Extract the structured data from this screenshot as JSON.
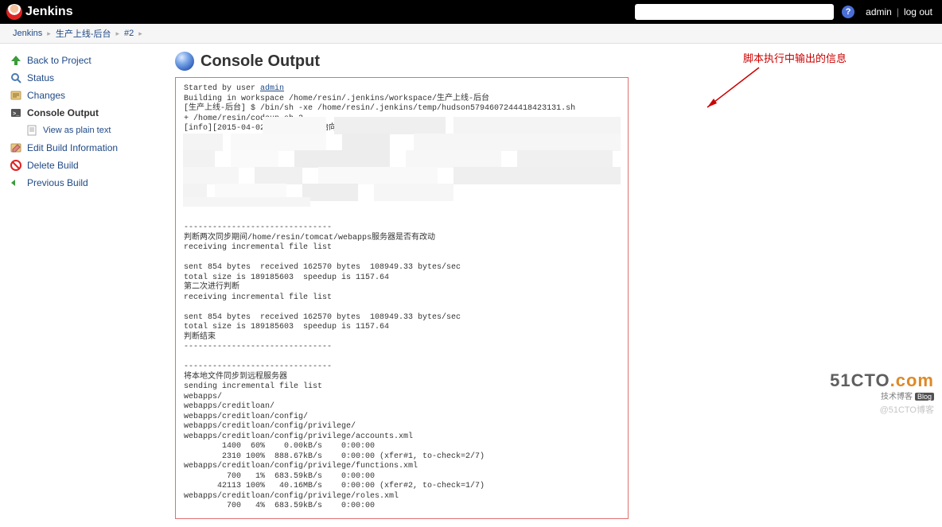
{
  "header": {
    "brand": "Jenkins",
    "search_placeholder": "",
    "admin_label": "admin",
    "logout_label": "log out"
  },
  "breadcrumbs": {
    "items": [
      "Jenkins",
      "生产上线-后台",
      "#2"
    ]
  },
  "sidebar": {
    "back": "Back to Project",
    "status": "Status",
    "changes": "Changes",
    "console": "Console Output",
    "viewplain": "View as plain text",
    "editbuild": "Edit Build Information",
    "delete": "Delete Build",
    "previous": "Previous Build"
  },
  "page": {
    "title": "Console Output"
  },
  "annotation": {
    "text": "脚本执行中输出的信息"
  },
  "watermark": {
    "main1": "51CTO",
    "main2": ".com",
    "sub": "技术博客",
    "blog": "Blog",
    "at": "@51CTO博客"
  },
  "console": {
    "line_started": "Started by user ",
    "admin_link": "admin",
    "block1": "Building in workspace /home/resin/.jenkins/workspace/生产上线-后台\n[生产上线-后台] $ /bin/sh -xe /home/resin/.jenkins/temp/hudson5794607244418423131.sh\n+ /home/resin/codeup.sh 2\n[info][2015-04-02 18:56:49]开始向",
    "block2": "-------------------------------\n判断两次同步期间/home/resin/tomcat/webapps服务器是否有改动\nreceiving incremental file list\n\nsent 854 bytes  received 162570 bytes  108949.33 bytes/sec\ntotal size is 189185603  speedup is 1157.64\n第二次进行判断\nreceiving incremental file list\n\nsent 854 bytes  received 162570 bytes  108949.33 bytes/sec\ntotal size is 189185603  speedup is 1157.64\n判断结束\n-------------------------------\n\n-------------------------------\n将本地文件同步到远程服务器\nsending incremental file list\nwebapps/\nwebapps/creditloan/\nwebapps/creditloan/config/\nwebapps/creditloan/config/privilege/\nwebapps/creditloan/config/privilege/accounts.xml\n        1400  60%    0.00kB/s    0:00:00\n        2310 100%  888.67kB/s    0:00:00 (xfer#1, to-check=2/7)\nwebapps/creditloan/config/privilege/functions.xml\n         700   1%  683.59kB/s    0:00:00\n       42113 100%   40.16MB/s    0:00:00 (xfer#2, to-check=1/7)\nwebapps/creditloan/config/privilege/roles.xml\n         700   4%  683.59kB/s    0:00:00"
  }
}
